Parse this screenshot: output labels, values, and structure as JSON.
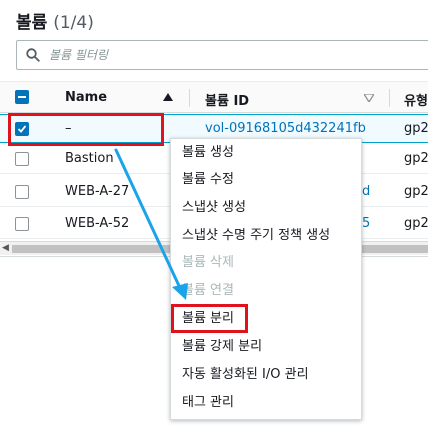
{
  "header": {
    "title": "볼륨",
    "count": "(1/4)"
  },
  "search": {
    "placeholder": "볼륨 필터링",
    "value": ""
  },
  "table": {
    "columns": [
      {
        "label": "Name",
        "sort": "ascending"
      },
      {
        "label": "볼륨 ID",
        "sort": "none"
      },
      {
        "label": "유형"
      }
    ],
    "rows": [
      {
        "name": "–",
        "volume_id": "vol-09168105d432241fb",
        "type": "gp2",
        "selected": true
      },
      {
        "name": "Bastion",
        "volume_id": "",
        "type": "gp2",
        "selected": false
      },
      {
        "name": "WEB-A-27",
        "volume_id": "d",
        "type": "gp2",
        "selected": false
      },
      {
        "name": "WEB-A-52",
        "volume_id": "5",
        "type": "gp2",
        "selected": false
      }
    ]
  },
  "context_menu": {
    "items": [
      {
        "label": "볼륨 생성",
        "disabled": false
      },
      {
        "label": "볼륨 수정",
        "disabled": false
      },
      {
        "label": "스냅샷 생성",
        "disabled": false
      },
      {
        "label": "스냅샷 수명 주기 정책 생성",
        "disabled": false
      },
      {
        "label": "볼륨 삭제",
        "disabled": true
      },
      {
        "label": "볼륨 연결",
        "disabled": true
      },
      {
        "label": "볼륨 분리",
        "disabled": false,
        "highlighted": true
      },
      {
        "label": "볼륨 강제 분리",
        "disabled": false
      },
      {
        "label": "자동 활성화된 I/O 관리",
        "disabled": false
      },
      {
        "label": "태그 관리",
        "disabled": false
      }
    ]
  },
  "colors": {
    "accent": "#0073bb",
    "annotation_red": "#e0121b",
    "annotation_arrow": "#1aa3e8"
  },
  "icons": {
    "search": "search-icon",
    "sort_asc": "sort-up-icon",
    "sort_none": "sort-down-icon",
    "check": "check-icon"
  }
}
